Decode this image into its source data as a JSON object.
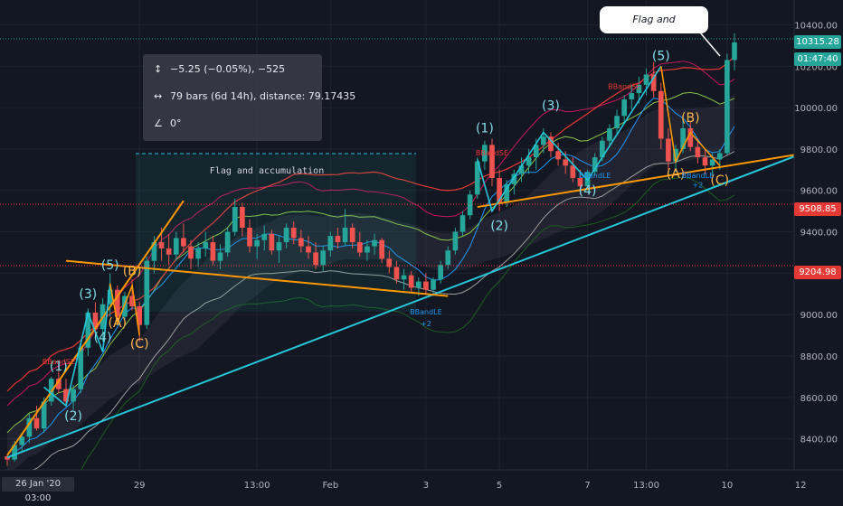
{
  "chart_data": {
    "type": "candlestick",
    "instrument_note": "",
    "x_tick_labels": [
      "29",
      "13:00",
      "Feb",
      "3",
      "5",
      "7",
      "13:00",
      "10",
      "12"
    ],
    "cursor_date_label": "26 Jan '20  03:00",
    "y_tick_labels": [
      "10400.00",
      "10200.00",
      "10000.00",
      "9800.00",
      "9600.00",
      "9400.00",
      "9200.00",
      "9000.00",
      "8800.00",
      "8600.00",
      "8400.00"
    ],
    "ylim": [
      8250,
      10520
    ],
    "price_badges": [
      {
        "label": "10315.28",
        "value": 10315.28,
        "color": "#26a69a"
      },
      {
        "label": "01:47:40",
        "value": 10233,
        "color": "#26a69a"
      },
      {
        "label": "9508.85",
        "value": 9508.85,
        "color": "#e53935"
      },
      {
        "label": "9204.98",
        "value": 9204.98,
        "color": "#e53935"
      }
    ],
    "measure_tool": {
      "price_change": "−5.25 (−0.05%), −525",
      "bars_info": "79 bars (6d 14h), distance: 79.17435",
      "angle": "0°"
    },
    "callout": "Flag and accumulation",
    "box_label": "Flag and accumulation",
    "wave_labels_cyan": [
      {
        "text": "(1)",
        "bar": 7,
        "price": 8730
      },
      {
        "text": "(2)",
        "bar": 9,
        "price": 8490
      },
      {
        "text": "(3)",
        "bar": 11,
        "price": 9080
      },
      {
        "text": "(4)",
        "bar": 13,
        "price": 8870
      },
      {
        "text": "(5)",
        "bar": 14,
        "price": 9220
      },
      {
        "text": "(1)",
        "bar": 65,
        "price": 9880
      },
      {
        "text": "(2)",
        "bar": 67,
        "price": 9410
      },
      {
        "text": "(3)",
        "bar": 74,
        "price": 9990
      },
      {
        "text": "(4)",
        "bar": 79,
        "price": 9580
      },
      {
        "text": "(5)",
        "bar": 89,
        "price": 10230
      }
    ],
    "wave_labels_orange": [
      {
        "text": "(B)",
        "bar": 17,
        "price": 9190
      },
      {
        "text": "(A)",
        "bar": 15,
        "price": 8940
      },
      {
        "text": "(C)",
        "bar": 18,
        "price": 8840
      },
      {
        "text": "(B)",
        "bar": 93,
        "price": 9930
      },
      {
        "text": "(A)",
        "bar": 91,
        "price": 9660
      },
      {
        "text": "(C)",
        "bar": 97,
        "price": 9630
      }
    ],
    "signal_labels": [
      {
        "text": "BBandLE",
        "bar": 57,
        "price": 9000,
        "color": "#2196f3"
      },
      {
        "text": "+2",
        "bar": 57,
        "price": 8945,
        "color": "#2196f3"
      },
      {
        "text": "BBandLE",
        "bar": 80,
        "price": 9660,
        "color": "#2196f3"
      },
      {
        "text": "+2",
        "bar": 94,
        "price": 9615,
        "color": "#2196f3"
      },
      {
        "text": "BBandLE",
        "bar": 94,
        "price": 9660,
        "color": "#2196f3"
      },
      {
        "text": "BBandSE",
        "bar": 66,
        "price": 9770,
        "color": "#e53935"
      },
      {
        "text": "BBandSE",
        "bar": 84,
        "price": 10090,
        "color": "#e53935"
      },
      {
        "text": "BBandSE",
        "bar": 7,
        "price": 8760,
        "color": "#e53935"
      }
    ],
    "candles": [
      [
        8315,
        8320,
        8270,
        8300
      ],
      [
        8300,
        8390,
        8290,
        8370
      ],
      [
        8370,
        8420,
        8340,
        8410
      ],
      [
        8410,
        8520,
        8380,
        8500
      ],
      [
        8500,
        8560,
        8440,
        8450
      ],
      [
        8450,
        8600,
        8430,
        8580
      ],
      [
        8580,
        8700,
        8560,
        8690
      ],
      [
        8690,
        8760,
        8620,
        8640
      ],
      [
        8640,
        8690,
        8560,
        8580
      ],
      [
        8580,
        8660,
        8540,
        8640
      ],
      [
        8640,
        8860,
        8620,
        8840
      ],
      [
        8840,
        9030,
        8800,
        9010
      ],
      [
        9010,
        9060,
        8900,
        8930
      ],
      [
        8930,
        9080,
        8870,
        9050
      ],
      [
        9050,
        9200,
        8990,
        9120
      ],
      [
        9120,
        9140,
        8950,
        8990
      ],
      [
        8990,
        9110,
        8960,
        9090
      ],
      [
        9090,
        9170,
        9020,
        9040
      ],
      [
        9040,
        9060,
        8870,
        8950
      ],
      [
        8950,
        9280,
        8930,
        9260
      ],
      [
        9260,
        9380,
        9200,
        9350
      ],
      [
        9350,
        9420,
        9260,
        9320
      ],
      [
        9320,
        9390,
        9240,
        9290
      ],
      [
        9290,
        9400,
        9260,
        9370
      ],
      [
        9370,
        9440,
        9300,
        9330
      ],
      [
        9330,
        9360,
        9220,
        9270
      ],
      [
        9270,
        9350,
        9230,
        9320
      ],
      [
        9320,
        9400,
        9280,
        9350
      ],
      [
        9350,
        9380,
        9240,
        9260
      ],
      [
        9260,
        9340,
        9220,
        9300
      ],
      [
        9300,
        9420,
        9280,
        9400
      ],
      [
        9400,
        9560,
        9380,
        9520
      ],
      [
        9520,
        9540,
        9380,
        9420
      ],
      [
        9420,
        9460,
        9300,
        9330
      ],
      [
        9330,
        9390,
        9270,
        9360
      ],
      [
        9360,
        9430,
        9310,
        9390
      ],
      [
        9390,
        9410,
        9290,
        9310
      ],
      [
        9310,
        9380,
        9250,
        9350
      ],
      [
        9350,
        9440,
        9320,
        9420
      ],
      [
        9420,
        9450,
        9340,
        9370
      ],
      [
        9370,
        9410,
        9300,
        9330
      ],
      [
        9330,
        9380,
        9270,
        9300
      ],
      [
        9300,
        9350,
        9220,
        9240
      ],
      [
        9240,
        9330,
        9210,
        9310
      ],
      [
        9310,
        9400,
        9280,
        9380
      ],
      [
        9380,
        9420,
        9320,
        9350
      ],
      [
        9350,
        9510,
        9330,
        9420
      ],
      [
        9420,
        9440,
        9320,
        9350
      ],
      [
        9350,
        9400,
        9280,
        9300
      ],
      [
        9300,
        9360,
        9260,
        9330
      ],
      [
        9330,
        9390,
        9290,
        9360
      ],
      [
        9360,
        9370,
        9250,
        9270
      ],
      [
        9270,
        9310,
        9200,
        9230
      ],
      [
        9230,
        9260,
        9150,
        9170
      ],
      [
        9170,
        9220,
        9120,
        9190
      ],
      [
        9190,
        9210,
        9110,
        9130
      ],
      [
        9130,
        9180,
        9090,
        9160
      ],
      [
        9160,
        9200,
        9100,
        9120
      ],
      [
        9120,
        9180,
        9090,
        9170
      ],
      [
        9170,
        9260,
        9150,
        9240
      ],
      [
        9240,
        9330,
        9220,
        9310
      ],
      [
        9310,
        9420,
        9290,
        9400
      ],
      [
        9400,
        9500,
        9380,
        9480
      ],
      [
        9480,
        9600,
        9460,
        9580
      ],
      [
        9580,
        9760,
        9560,
        9740
      ],
      [
        9740,
        9840,
        9700,
        9820
      ],
      [
        9820,
        9850,
        9620,
        9660
      ],
      [
        9660,
        9700,
        9500,
        9540
      ],
      [
        9540,
        9650,
        9520,
        9630
      ],
      [
        9630,
        9700,
        9580,
        9680
      ],
      [
        9680,
        9760,
        9640,
        9720
      ],
      [
        9720,
        9800,
        9680,
        9760
      ],
      [
        9760,
        9850,
        9700,
        9820
      ],
      [
        9820,
        9900,
        9780,
        9860
      ],
      [
        9860,
        9880,
        9760,
        9790
      ],
      [
        9790,
        9830,
        9720,
        9750
      ],
      [
        9750,
        9790,
        9680,
        9720
      ],
      [
        9720,
        9760,
        9640,
        9660
      ],
      [
        9660,
        9700,
        9580,
        9620
      ],
      [
        9620,
        9700,
        9600,
        9690
      ],
      [
        9690,
        9780,
        9670,
        9760
      ],
      [
        9760,
        9860,
        9740,
        9840
      ],
      [
        9840,
        9920,
        9810,
        9900
      ],
      [
        9900,
        9990,
        9870,
        9960
      ],
      [
        9960,
        10060,
        9930,
        10040
      ],
      [
        10040,
        10110,
        9990,
        10070
      ],
      [
        10070,
        10150,
        10020,
        10110
      ],
      [
        10110,
        10190,
        10060,
        10160
      ],
      [
        10160,
        10220,
        10050,
        10080
      ],
      [
        10080,
        10120,
        9800,
        9850
      ],
      [
        9850,
        9900,
        9700,
        9740
      ],
      [
        9740,
        9820,
        9690,
        9800
      ],
      [
        9800,
        9940,
        9780,
        9900
      ],
      [
        9900,
        9930,
        9790,
        9810
      ],
      [
        9810,
        9850,
        9730,
        9760
      ],
      [
        9760,
        9800,
        9680,
        9720
      ],
      [
        9720,
        9780,
        9670,
        9750
      ],
      [
        9750,
        9800,
        9700,
        9780
      ],
      [
        9780,
        10260,
        9770,
        10230
      ],
      [
        10230,
        10360,
        10180,
        10315.28
      ]
    ],
    "trendlines": [
      {
        "color": "#26c6da",
        "points": [
          [
            0,
            8310
          ],
          [
            112,
            9830
          ]
        ]
      },
      {
        "color": "#ff9800",
        "points": [
          [
            0,
            8320
          ],
          [
            24,
            9550
          ]
        ]
      },
      {
        "color": "#ff9800",
        "points": [
          [
            8,
            9260
          ],
          [
            60,
            9090
          ]
        ]
      },
      {
        "color": "#ff9800",
        "points": [
          [
            64,
            9520
          ],
          [
            112,
            9800
          ]
        ]
      }
    ],
    "wave_paths": [
      {
        "color": "#26c6da",
        "points": [
          [
            5,
            8650
          ],
          [
            8,
            8560
          ],
          [
            11,
            9010
          ],
          [
            13,
            8820
          ],
          [
            14,
            9150
          ]
        ]
      },
      {
        "color": "#26c6da",
        "points": [
          [
            64,
            9750
          ],
          [
            66,
            9500
          ],
          [
            73,
            9880
          ],
          [
            79,
            9650
          ],
          [
            89,
            10200
          ]
        ]
      },
      {
        "color": "#ff9800",
        "points": [
          [
            14,
            9150
          ],
          [
            15,
            8960
          ],
          [
            17,
            9140
          ],
          [
            18,
            8900
          ]
        ]
      },
      {
        "color": "#ff9800",
        "points": [
          [
            89,
            10200
          ],
          [
            91,
            9740
          ],
          [
            93,
            9880
          ],
          [
            97,
            9720
          ]
        ]
      }
    ]
  }
}
